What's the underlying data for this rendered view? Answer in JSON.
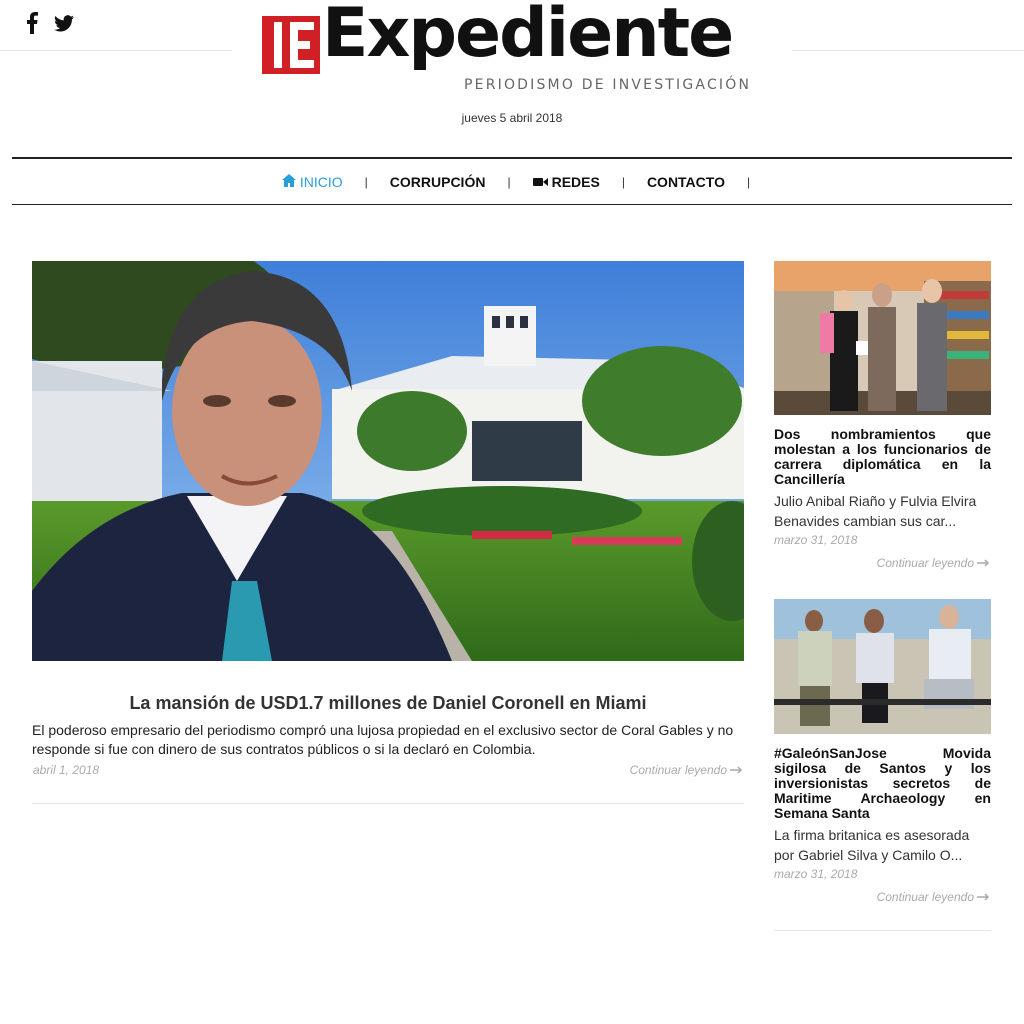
{
  "social": {
    "facebook_icon": "facebook-icon",
    "twitter_icon": "twitter-icon"
  },
  "logo": {
    "mark": "E",
    "word": "Expediente",
    "tagline": "PERIODISMO DE INVESTIGACIÓN",
    "brand_color": "#d11f26"
  },
  "date": "jueves 5 abril 2018",
  "nav": {
    "items": [
      {
        "label": "INICIO",
        "icon": "home-icon",
        "active": true
      },
      {
        "label": "CORRUPCIÓN"
      },
      {
        "label": "REDES",
        "icon": "video-camera-icon"
      },
      {
        "label": "CONTACTO"
      }
    ],
    "separator": "|",
    "active_color": "#2a9fd6"
  },
  "main_article": {
    "title": "La mansión de USD1.7 millones de Daniel Coronell en Miami",
    "excerpt": "El poderoso empresario del periodismo compró una lujosa propiedad en el exclusivo sector de Coral Gables y no responde si fue con dinero de sus contratos públicos o si la declaró en Colombia.",
    "date": "abril 1, 2018",
    "more": "Continuar leyendo"
  },
  "sidebar": [
    {
      "title": "Dos nombramientos que molestan a los funcionarios de carrera diplomática en la Cancillería",
      "excerpt": "Julio Anibal Riaño y Fulvia Elvira Benavides cambian sus car...",
      "date": "marzo 31, 2018",
      "more": "Continuar leyendo"
    },
    {
      "title": "#GaleónSanJose Movida sigilosa de Santos y los inversionistas secretos de Maritime Archaeology en Semana Santa",
      "excerpt": "La firma britanica es asesorada por Gabriel Silva y Camilo O...",
      "date": "marzo 31, 2018",
      "more": "Continuar leyendo"
    }
  ]
}
